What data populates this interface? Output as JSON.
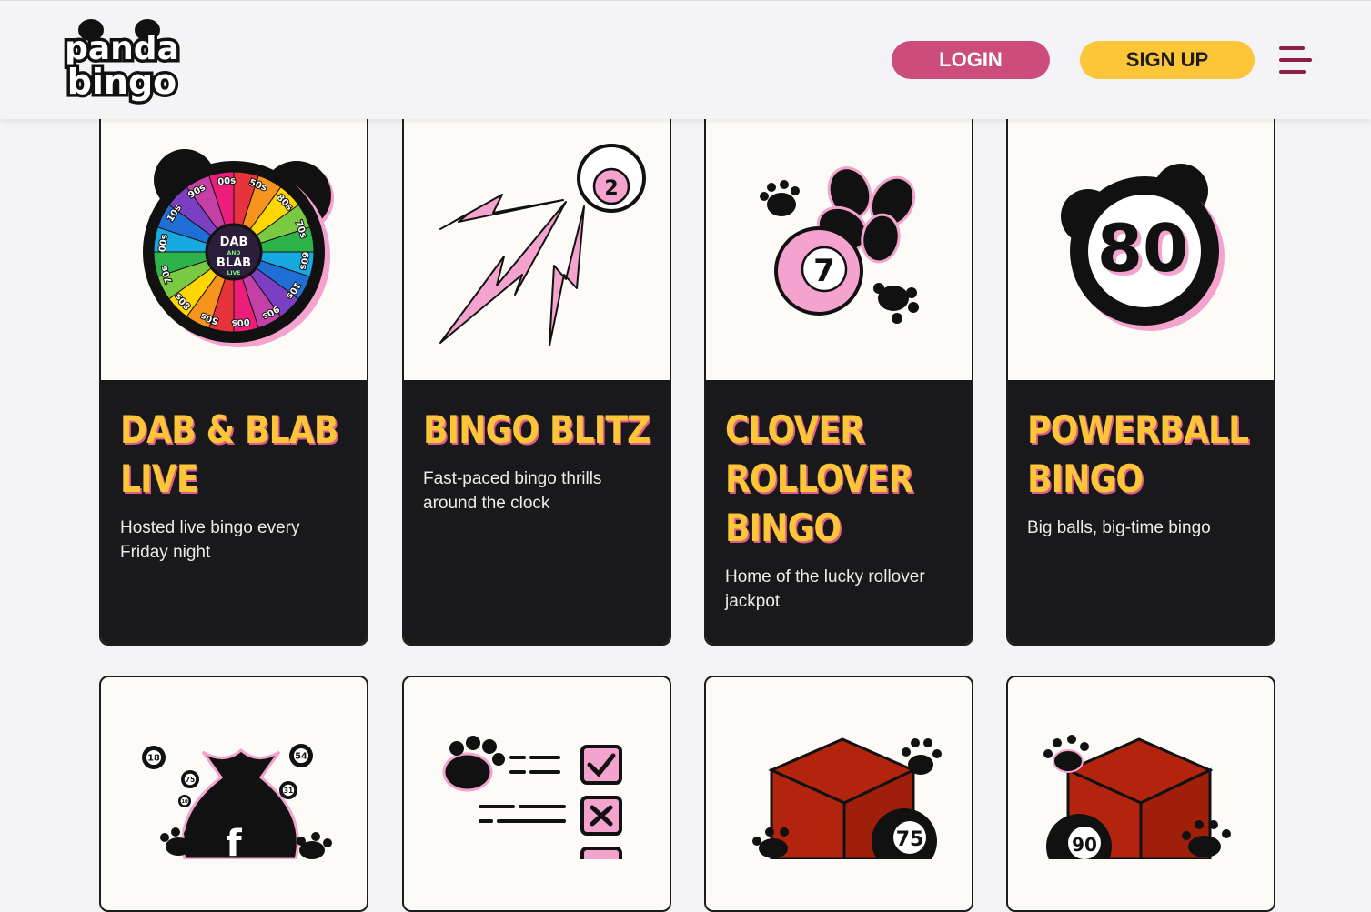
{
  "header": {
    "logo_top": "panda",
    "logo_bottom": "bingo",
    "login_label": "LOGIN",
    "signup_label": "SIGN UP"
  },
  "games": [
    {
      "title": "DAB & BLAB LIVE",
      "description": "Hosted live bingo every Friday night",
      "wheel_center_top": "DAB",
      "wheel_center_mid": "AND",
      "wheel_center_bottom": "BLAB",
      "wheel_center_tag": "LIVE",
      "wheel_labels": [
        "50s",
        "80s",
        "70s",
        "60s",
        "10s",
        "90s",
        "00s",
        "50s",
        "80s",
        "70s",
        "00s",
        "10s",
        "90s",
        "00s"
      ]
    },
    {
      "title": "BINGO BLITZ",
      "description": "Fast-paced bingo thrills around the clock",
      "ball_number": "2"
    },
    {
      "title": "CLOVER ROLLOVER BINGO",
      "description": "Home of the lucky rollover jackpot",
      "ball_number": "7"
    },
    {
      "title": "POWERBALL BINGO",
      "description": "Big balls, big-time bingo",
      "ball_number": "80"
    }
  ],
  "bottom_cards": [
    {
      "name": "bonus-bag",
      "balls": [
        "18",
        "75",
        "54",
        "31",
        "10"
      ]
    },
    {
      "name": "checklist"
    },
    {
      "name": "box-75",
      "ball_number": "75"
    },
    {
      "name": "box-90",
      "ball_number": "90"
    }
  ],
  "colors": {
    "login_bg": "#cc4d7a",
    "signup_bg": "#fcc638",
    "title_yellow": "#fcc638",
    "pink": "#f4a3cf",
    "card_dark": "#19191b",
    "menu_icon": "#8a1e45",
    "box_red": "#b3240e"
  }
}
